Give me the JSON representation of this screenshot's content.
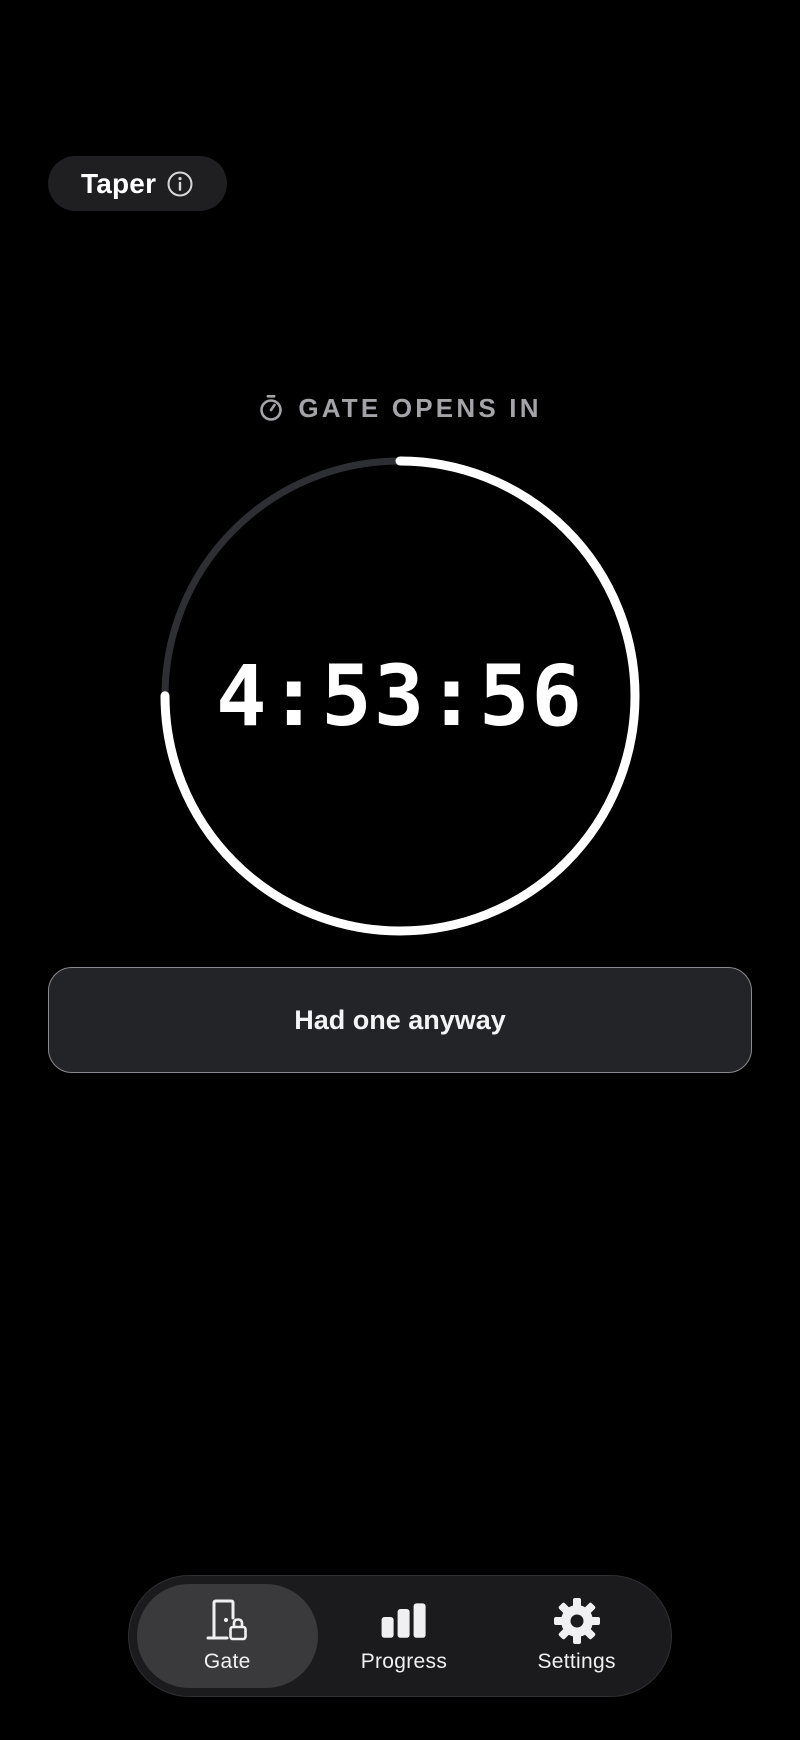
{
  "header": {
    "app_name": "Taper",
    "info_icon": "info-circle-icon"
  },
  "timer": {
    "caption": "GATE OPENS IN",
    "caption_icon": "stopwatch-icon",
    "countdown": "4:53:56",
    "progress_fraction": 0.75,
    "ring_color": "#ffffff",
    "track_color": "#2e2f33"
  },
  "actions": {
    "had_one_label": "Had one anyway"
  },
  "tabbar": {
    "tabs": [
      {
        "label": "Gate",
        "icon": "door-lock-icon",
        "active": true
      },
      {
        "label": "Progress",
        "icon": "bar-chart-icon",
        "active": false
      },
      {
        "label": "Settings",
        "icon": "gear-icon",
        "active": false
      }
    ]
  },
  "colors": {
    "background": "#000000",
    "surface": "#232428",
    "accent": "#ffffff",
    "muted_text": "#a3a3a8"
  }
}
